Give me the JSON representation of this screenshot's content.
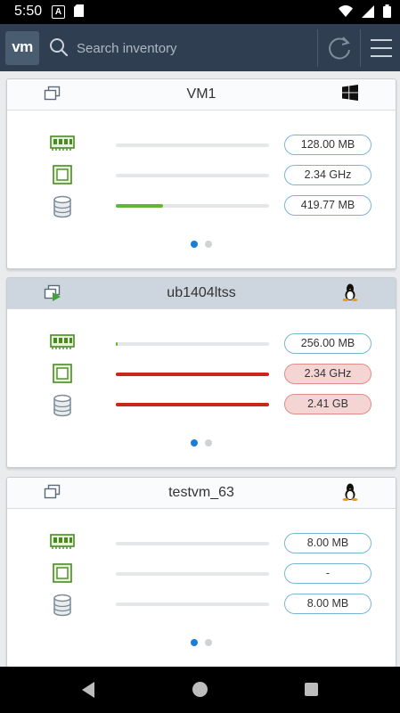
{
  "status_bar": {
    "time": "5:50"
  },
  "header": {
    "logo": "vm",
    "search_placeholder": "Search inventory"
  },
  "colors": {
    "accent": "#1a7fd4",
    "header_bg": "#2f3e50",
    "ok_bar": "#63b630",
    "alert_bar": "#c9271c",
    "alert_pill": "#f5d5d3"
  },
  "vms": [
    {
      "name": "VM1",
      "state_icon": "vm-icon",
      "os_icon": "windows-icon",
      "memory": {
        "label": "128.00 MB",
        "usage": 0.0,
        "alert": false
      },
      "cpu": {
        "label": "2.34 GHz",
        "usage": 0.0,
        "alert": false
      },
      "storage": {
        "label": "419.77 MB",
        "usage": 0.31,
        "alert": false
      },
      "page": 1,
      "pages": 2
    },
    {
      "name": "ub1404ltss",
      "state_icon": "vm-powered-on-icon",
      "os_icon": "linux-icon",
      "memory": {
        "label": "256.00 MB",
        "usage": 0.01,
        "alert": false
      },
      "cpu": {
        "label": "2.34 GHz",
        "usage": 1.0,
        "alert": true
      },
      "storage": {
        "label": "2.41 GB",
        "usage": 1.0,
        "alert": true
      },
      "page": 1,
      "pages": 2
    },
    {
      "name": "testvm_63",
      "state_icon": "vm-icon",
      "os_icon": "linux-icon",
      "memory": {
        "label": "8.00 MB",
        "usage": 0.0,
        "alert": false
      },
      "cpu": {
        "label": "-",
        "usage": 0.0,
        "alert": false
      },
      "storage": {
        "label": "8.00 MB",
        "usage": 0.0,
        "alert": false
      },
      "page": 1,
      "pages": 2
    }
  ]
}
